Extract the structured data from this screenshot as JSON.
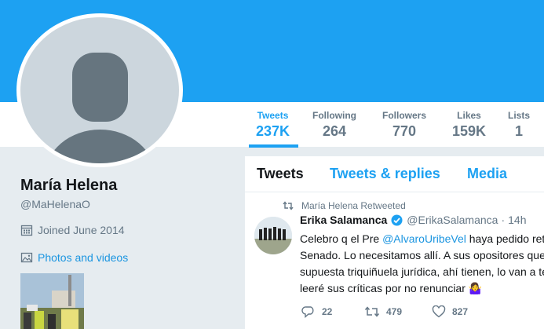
{
  "colors": {
    "brand": "#1da1f2",
    "link": "#1b95e0",
    "muted": "#657786",
    "background": "#e6ecf0",
    "avatar_placeholder": "#ccd6dd"
  },
  "nav": {
    "stats": [
      {
        "label": "Tweets",
        "value": "237K",
        "active": true
      },
      {
        "label": "Following",
        "value": "264",
        "active": false
      },
      {
        "label": "Followers",
        "value": "770",
        "active": false
      },
      {
        "label": "Likes",
        "value": "159K",
        "active": false
      },
      {
        "label": "Lists",
        "value": "1",
        "active": false
      }
    ]
  },
  "profile": {
    "name": "María Helena",
    "handle": "@MaHelenaO",
    "joined": "Joined June 2014",
    "photos_link": "Photos and videos",
    "calendar_icon": "calendar-icon",
    "photo_icon": "photo-icon"
  },
  "timeline": {
    "tabs": [
      {
        "label": "Tweets",
        "active": true
      },
      {
        "label": "Tweets & replies",
        "active": false
      },
      {
        "label": "Media",
        "active": false
      }
    ],
    "tweet": {
      "retweet_context": "María Helena Retweeted",
      "author_name": "Erika Salamanca",
      "author_handle": "@ErikaSalamanca",
      "separator": "·",
      "time": "14h",
      "text_line1_prefix": "Celebro q el Pre ",
      "mention": "@AlvaroUribeVel",
      "text_line1_suffix": " haya pedido ret",
      "text_line2": "Senado. Lo necesitamos allí. A sus opositores que",
      "text_line3": "supuesta triquiñuela jurídica, ahí tienen, lo van a te",
      "text_line4": "leeré sus críticas por no renunciar",
      "emoji": "🤷‍♀️",
      "replies": "22",
      "retweets": "479",
      "likes": "827"
    }
  }
}
